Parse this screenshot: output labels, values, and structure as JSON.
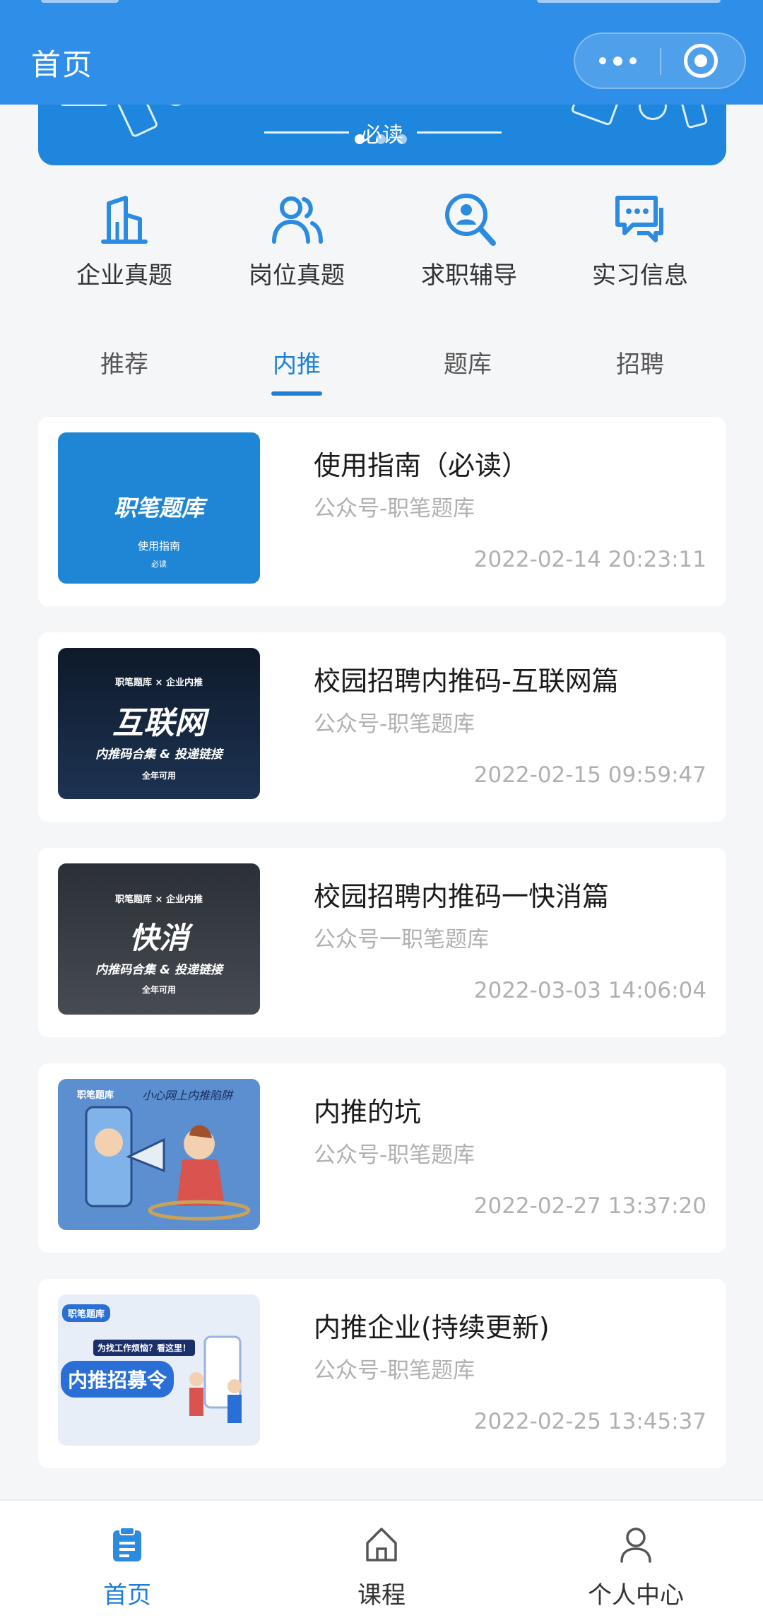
{
  "header": {
    "title": "首页"
  },
  "banner": {
    "text": "必读",
    "slide_count": 3,
    "active_slide": 1
  },
  "quick_menu": [
    {
      "label": "企业真题",
      "icon": "building-icon"
    },
    {
      "label": "岗位真题",
      "icon": "users-icon"
    },
    {
      "label": "求职辅导",
      "icon": "search-person-icon"
    },
    {
      "label": "实习信息",
      "icon": "chat-bubbles-icon"
    }
  ],
  "tabs": {
    "items": [
      "推荐",
      "内推",
      "题库",
      "招聘"
    ],
    "active": "内推"
  },
  "articles": [
    {
      "title": "使用指南（必读）",
      "source": "公众号-职笔题库",
      "date": "2022-02-14 20:23:11",
      "thumb_title": "职笔题库",
      "thumb_sub": "使用指南",
      "thumb_tag": "必读"
    },
    {
      "title": "校园招聘内推码-互联网篇",
      "source": "公众号-职笔题库",
      "date": "2022-02-15 09:59:47",
      "thumb_tag": "职笔题库 × 企业内推",
      "thumb_title": "互联网",
      "thumb_sub": "内推码合集 & 投递链接",
      "thumb_note": "全年可用"
    },
    {
      "title": "校园招聘内推码一快消篇",
      "source": "公众号一职笔题库",
      "date": "2022-03-03 14:06:04",
      "thumb_tag": "职笔题库 × 企业内推",
      "thumb_title": "快消",
      "thumb_sub": "内推码合集 & 投递链接",
      "thumb_note": "全年可用"
    },
    {
      "title": "内推的坑",
      "source": "公众号-职笔题库",
      "date": "2022-02-27 13:37:20",
      "thumb_tag": "职笔题库",
      "thumb_title": "小心网上内推陷阱"
    },
    {
      "title": "内推企业(持续更新)",
      "source": "公众号-职笔题库",
      "date": "2022-02-25 13:45:37",
      "thumb_tag": "职笔题库",
      "thumb_sub": "为找工作烦恼？看这里！",
      "thumb_title": "内推招募令"
    }
  ],
  "tabbar": [
    {
      "label": "首页",
      "icon": "clipboard-icon",
      "active": true
    },
    {
      "label": "课程",
      "icon": "home-icon",
      "active": false
    },
    {
      "label": "个人中心",
      "icon": "user-icon",
      "active": false
    }
  ],
  "colors": {
    "brand": "#2e8ee8",
    "accent": "#1f7fd8",
    "background": "#f5f6f8",
    "muted_text": "#b0b0b0"
  }
}
